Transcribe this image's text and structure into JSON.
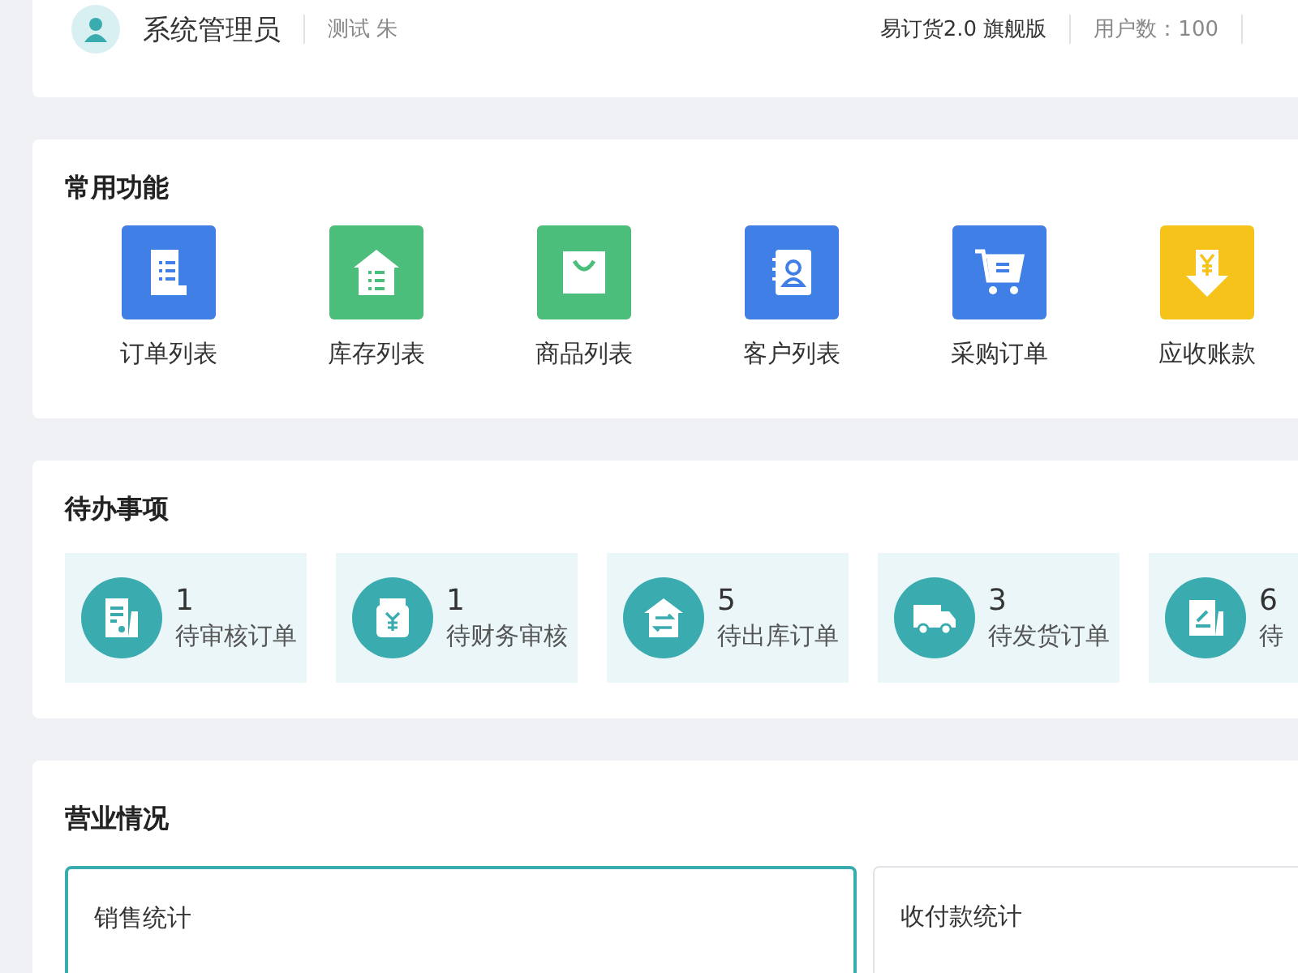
{
  "header": {
    "user": "系统管理员",
    "account": "测试 朱",
    "edition": "易订货2.0 旗舰版",
    "users": "用户数：100"
  },
  "shortcuts": {
    "title": "常用功能",
    "items": [
      {
        "label": "订单列表",
        "kind": "order",
        "color": "#3f7fe6"
      },
      {
        "label": "库存列表",
        "kind": "stock",
        "color": "#4cbe7b"
      },
      {
        "label": "商品列表",
        "kind": "goods",
        "color": "#4cbe7b"
      },
      {
        "label": "客户列表",
        "kind": "customer",
        "color": "#3f7fe6"
      },
      {
        "label": "采购订单",
        "kind": "purchase",
        "color": "#3f7fe6"
      },
      {
        "label": "应收账款",
        "kind": "receivable",
        "color": "#f5c319"
      }
    ]
  },
  "todos": {
    "title": "待办事项",
    "items": [
      {
        "count": "1",
        "label": "待审核订单",
        "kind": "review"
      },
      {
        "count": "1",
        "label": "待财务审核",
        "kind": "finance"
      },
      {
        "count": "5",
        "label": "待出库订单",
        "kind": "outbound"
      },
      {
        "count": "3",
        "label": "待发货订单",
        "kind": "ship"
      },
      {
        "count": "6",
        "label": "待",
        "kind": "sign"
      }
    ]
  },
  "business": {
    "title": "营业情况",
    "cards": [
      {
        "title": "销售统计",
        "selected": true
      },
      {
        "title": "收付款统计",
        "selected": false
      }
    ]
  }
}
